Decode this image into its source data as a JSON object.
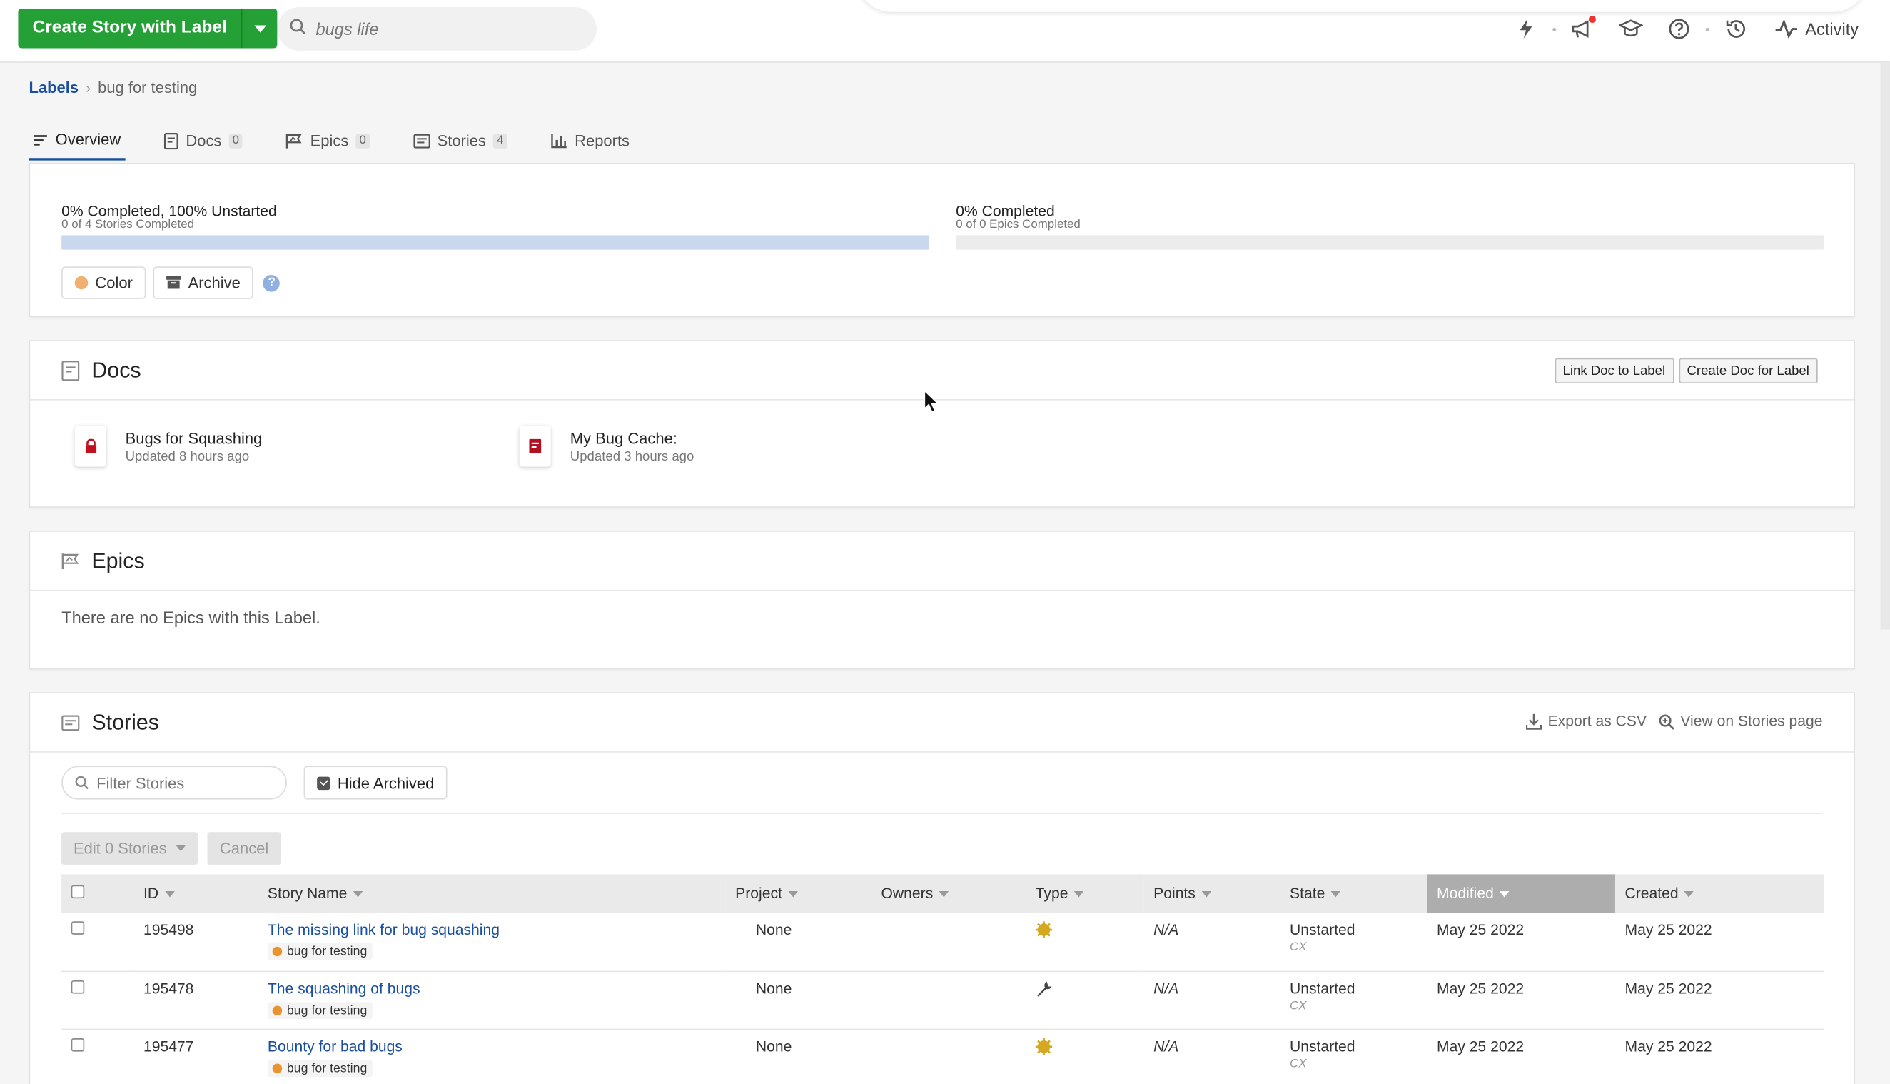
{
  "header": {
    "create_label": "Create Story with Label",
    "search_value": "bugs life",
    "activity_label": "Activity"
  },
  "breadcrumb": {
    "root": "Labels",
    "current": "bug for testing"
  },
  "tabs": [
    {
      "label": "Overview",
      "count": ""
    },
    {
      "label": "Docs",
      "count": "0"
    },
    {
      "label": "Epics",
      "count": "0"
    },
    {
      "label": "Stories",
      "count": "4"
    },
    {
      "label": "Reports",
      "count": ""
    }
  ],
  "overview": {
    "stories_progress_title": "0% Completed, 100% Unstarted",
    "stories_progress_sub": "0 of 4 Stories Completed",
    "stories_completed_fraction": 0,
    "epics_progress_title": "0% Completed",
    "epics_progress_sub": "0 of 0 Epics Completed",
    "color_label": "Color",
    "archive_label": "Archive",
    "label_color": "#f0b070"
  },
  "docs": {
    "title": "Docs",
    "link_btn": "Link Doc to Label",
    "create_btn": "Create Doc for Label",
    "items": [
      {
        "name": "Bugs for Squashing",
        "updated": "Updated 8 hours ago",
        "icon": "lock-icon"
      },
      {
        "name": "My Bug Cache:",
        "updated": "Updated 3 hours ago",
        "icon": "doc-icon"
      }
    ]
  },
  "epics": {
    "title": "Epics",
    "empty": "There are no Epics with this Label."
  },
  "stories": {
    "title": "Stories",
    "export_label": "Export as CSV",
    "view_label": "View on Stories page",
    "filter_placeholder": "Filter Stories",
    "hide_archived_label": "Hide Archived",
    "edit_label": "Edit 0 Stories",
    "cancel_label": "Cancel",
    "columns": [
      "ID",
      "Story Name",
      "Project",
      "Owners",
      "Type",
      "Points",
      "State",
      "Modified",
      "Created"
    ],
    "rows": [
      {
        "id": "195498",
        "name": "The missing link for bug squashing",
        "label": "bug for testing",
        "project": "None",
        "type": "feature",
        "points": "N/A",
        "state": "Unstarted",
        "state_sub": "CX",
        "modified": "May 25 2022",
        "created": "May 25 2022"
      },
      {
        "id": "195478",
        "name": "The squashing of bugs",
        "label": "bug for testing",
        "project": "None",
        "type": "chore",
        "points": "N/A",
        "state": "Unstarted",
        "state_sub": "CX",
        "modified": "May 25 2022",
        "created": "May 25 2022"
      },
      {
        "id": "195477",
        "name": "Bounty for bad bugs",
        "label": "bug for testing",
        "project": "None",
        "type": "feature",
        "points": "N/A",
        "state": "Unstarted",
        "state_sub": "CX",
        "modified": "May 25 2022",
        "created": "May 25 2022"
      }
    ]
  }
}
